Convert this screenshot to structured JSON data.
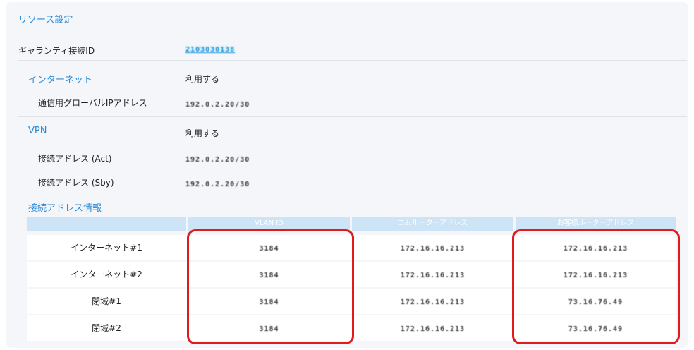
{
  "section_title": "リソース設定",
  "rows": {
    "guaranty_label": "ギャランティ接続ID",
    "guaranty_value": "2103030138",
    "internet_label": "インターネット",
    "internet_value": "利用する",
    "global_ip_label": "通信用グローバルIPアドレス",
    "global_ip_value": "192.0.2.20/30",
    "vpn_label": "VPN",
    "vpn_value": "利用する",
    "act_label": "接続アドレス (Act)",
    "act_value": "192.0.2.20/30",
    "sby_label": "接続アドレス (Sby)",
    "sby_value": "192.0.2.20/30"
  },
  "address_info": {
    "heading": "接続アドレス情報",
    "columns": [
      "",
      "VLAN ID",
      "コムルーターアドレス",
      "お客様ルーターアドレス"
    ],
    "rows": [
      {
        "name": "インターネット#1",
        "vlan": "3184",
        "com_router": "172.16.16.213",
        "customer_router": "172.16.16.213"
      },
      {
        "name": "インターネット#2",
        "vlan": "3184",
        "com_router": "172.16.16.213",
        "customer_router": "172.16.16.213"
      },
      {
        "name": "閉域#1",
        "vlan": "3184",
        "com_router": "172.16.16.213",
        "customer_router": "73.16.76.49"
      },
      {
        "name": "閉域#2",
        "vlan": "3184",
        "com_router": "172.16.16.213",
        "customer_router": "73.16.76.49"
      }
    ]
  },
  "colors": {
    "accent": "#2a8bd6",
    "table_header": "#cde3f6",
    "highlight": "#e01b1b",
    "panel": "#f4f6f9"
  }
}
